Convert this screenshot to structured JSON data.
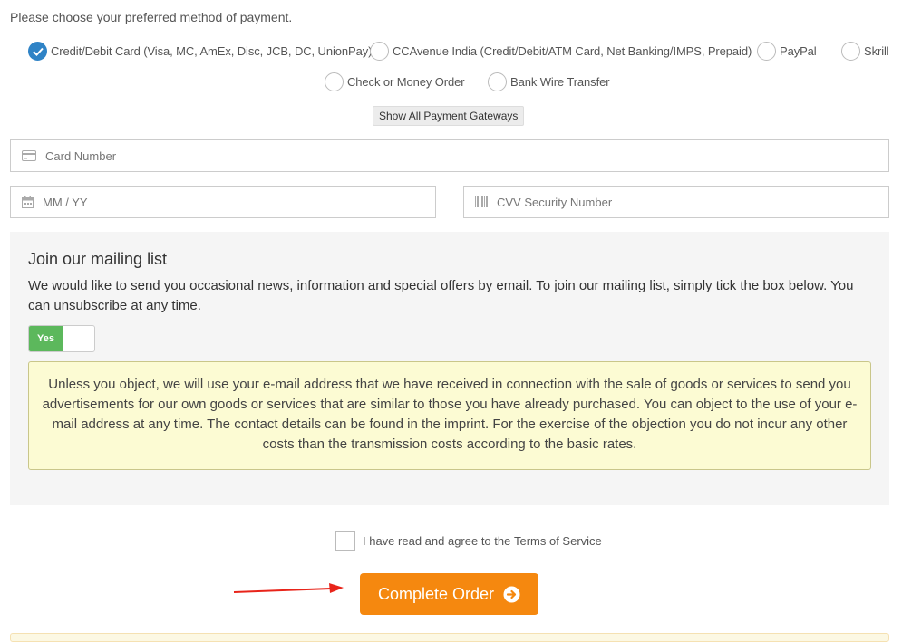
{
  "intro": "Please choose your preferred method of payment.",
  "payment_methods": [
    {
      "label": "Credit/Debit Card (Visa, MC, AmEx, Disc, JCB, DC, UnionPay)",
      "selected": true
    },
    {
      "label": "CCAvenue India (Credit/Debit/ATM Card, Net Banking/IMPS, Prepaid)",
      "selected": false
    },
    {
      "label": "PayPal",
      "selected": false
    },
    {
      "label": "Skrill",
      "selected": false
    },
    {
      "label": "Check or Money Order",
      "selected": false
    },
    {
      "label": "Bank Wire Transfer",
      "selected": false
    }
  ],
  "show_all_label": "Show All Payment Gateways",
  "card": {
    "number_placeholder": "Card Number",
    "expiry_placeholder": "MM / YY",
    "cvv_placeholder": "CVV Security Number",
    "icons": [
      "credit-card-icon",
      "calendar-icon",
      "barcode-icon"
    ]
  },
  "mailing": {
    "title": "Join our mailing list",
    "description": "We would like to send you occasional news, information and special offers by email. To join our mailing list, simply tick the box below. You can unsubscribe at any time.",
    "toggle_label": "Yes",
    "notice": "Unless you object, we will use your e-mail address that we have received in connection with the sale of goods or services to send you advertisements for our own goods or services that are similar to those you have already purchased. You can object to the use of your e-mail address at any time. The contact details can be found in the imprint. For the exercise of the objection you do not incur any other costs than the transmission costs according to the basic rates."
  },
  "tos": {
    "prefix": "I have read and agree to the ",
    "link": "Terms of Service"
  },
  "complete_label": "Complete Order",
  "colors": {
    "accent_blue": "#2f83c6",
    "toggle_green": "#5cb85c",
    "order_orange": "#f5880f",
    "notice_bg": "#fcfbd3",
    "annotation_arrow": "#e8241a"
  }
}
